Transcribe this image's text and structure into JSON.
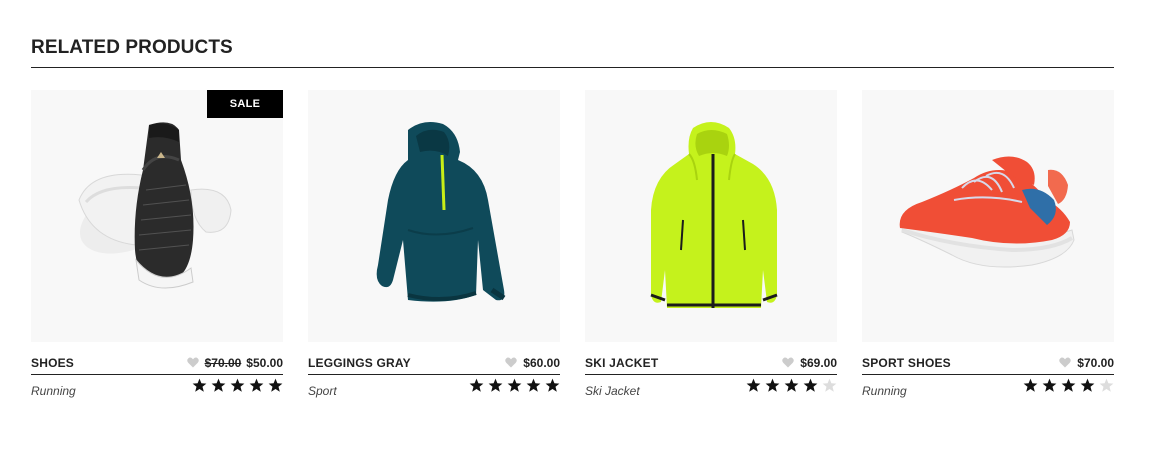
{
  "section": {
    "title": "RELATED PRODUCTS"
  },
  "products": [
    {
      "name": "SHOES",
      "badge": "SALE",
      "old_price": "$70.00",
      "price": "$50.00",
      "category": "Running",
      "rating": 5,
      "rating_max": 5,
      "image_icon": "sneaker-black-image"
    },
    {
      "name": "LEGGINGS GRAY",
      "badge": "",
      "old_price": "",
      "price": "$60.00",
      "category": "Sport",
      "rating": 5,
      "rating_max": 5,
      "image_icon": "hoodie-teal-image"
    },
    {
      "name": "SKI JACKET",
      "badge": "",
      "old_price": "",
      "price": "$69.00",
      "category": "Ski Jacket",
      "rating": 4,
      "rating_max": 5,
      "image_icon": "jacket-lime-image"
    },
    {
      "name": "SPORT SHOES",
      "badge": "",
      "old_price": "",
      "price": "$70.00",
      "category": "Running",
      "rating": 4,
      "rating_max": 5,
      "image_icon": "sneaker-red-image"
    }
  ],
  "colors": {
    "star_filled": "#111111",
    "star_empty": "#dddddd",
    "heart": "#cccccc",
    "badge_bg": "#000000",
    "image_bg": "#f8f8f8"
  }
}
